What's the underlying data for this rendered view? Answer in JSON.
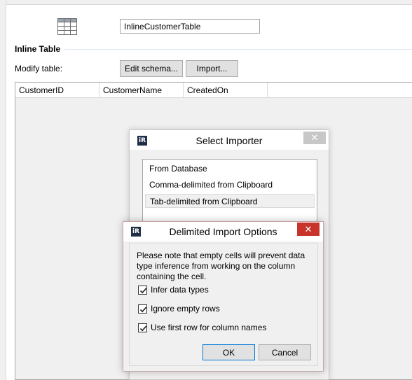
{
  "header": {
    "icon": "table-icon",
    "table_name_value": "InlineCustomerTable"
  },
  "section": {
    "title": "Inline Table",
    "modify_label": "Modify table:",
    "edit_schema_label": "Edit schema...",
    "import_label": "Import..."
  },
  "grid": {
    "columns": [
      "CustomerID",
      "CustomerName",
      "CreatedOn"
    ]
  },
  "select_importer": {
    "title": "Select Importer",
    "icon_text": "iR",
    "close_glyph": "✕",
    "items": [
      {
        "label": "From Database",
        "selected": false
      },
      {
        "label": "Comma-delimited from Clipboard",
        "selected": false
      },
      {
        "label": "Tab-delimited from Clipboard",
        "selected": true
      }
    ]
  },
  "delimited_options": {
    "title": "Delimited Import Options",
    "icon_text": "iR",
    "close_glyph": "✕",
    "note": "Please note that empty cells will prevent data type inference from working on the column containing the cell.",
    "options": [
      {
        "label": "Infer data types",
        "checked": true
      },
      {
        "label": "Ignore empty rows",
        "checked": true
      },
      {
        "label": "Use first row for column names",
        "checked": true
      }
    ],
    "ok_label": "OK",
    "cancel_label": "Cancel"
  },
  "colors": {
    "close_active": "#c8332b",
    "close_inactive": "#c7c7c7",
    "default_button_border": "#0078d7",
    "app_icon_bg": "#1f2f48"
  }
}
